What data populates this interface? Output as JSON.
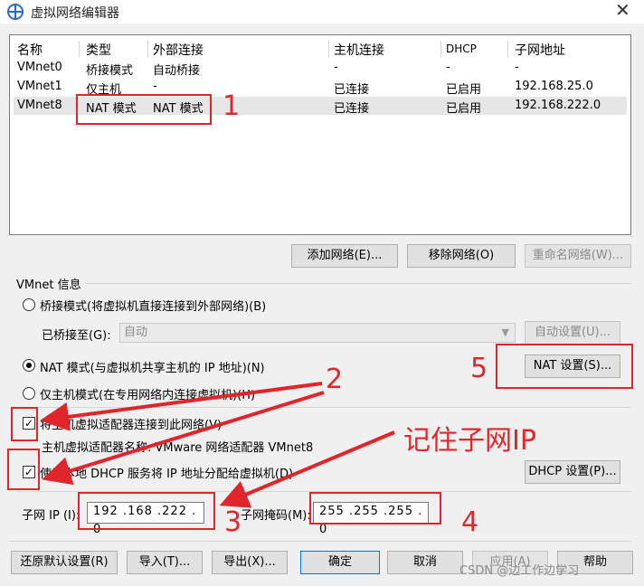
{
  "window": {
    "title": "虚拟网络编辑器",
    "close_glyph": "✕"
  },
  "table": {
    "headers": [
      "名称",
      "类型",
      "外部连接",
      "主机连接",
      "DHCP",
      "子网地址"
    ],
    "rows": [
      [
        "VMnet0",
        "桥接模式",
        "自动桥接",
        "-",
        "-",
        "-"
      ],
      [
        "VMnet1",
        "仅主机",
        "-",
        "已连接",
        "已启用",
        "192.168.25.0"
      ],
      [
        "VMnet8",
        "NAT 模式",
        "NAT 模式",
        "已连接",
        "已启用",
        "192.168.222.0"
      ]
    ]
  },
  "table_buttons": {
    "add": "添加网络(E)...",
    "remove": "移除网络(O)",
    "rename": "重命名网络(W)..."
  },
  "vmnet_info": {
    "section_label": "VMnet 信息",
    "bridge_radio": "桥接模式(将虚拟机直接连接到外部网络)(B)",
    "bridged_to_label": "已桥接至(G):",
    "bridged_to_value": "自动",
    "auto_settings": "自动设置(U)...",
    "nat_radio": "NAT 模式(与虚拟机共享主机的 IP 地址)(N)",
    "nat_settings": "NAT 设置(S)...",
    "hostonly_radio": "仅主机模式(在专用网络内连接虚拟机)(H)",
    "connect_adapter_check": "将主机虚拟适配器连接到此网络(V)",
    "adapter_name_label": "主机虚拟适配器名称: VMware 网络适配器 VMnet8",
    "dhcp_check": "使用本地 DHCP 服务将 IP 地址分配给虚拟机(D)",
    "dhcp_settings": "DHCP 设置(P)...",
    "subnet_ip_label": "子网 IP (I):",
    "subnet_ip_value": "192 .168 .222 . 0",
    "subnet_mask_label": "子网掩码(M):",
    "subnet_mask_value": "255 .255 .255 . 0"
  },
  "bottom_buttons": {
    "restore": "还原默认设置(R)",
    "import": "导入(T)...",
    "export": "导出(X)...",
    "ok": "确定",
    "cancel": "取消",
    "apply": "应用(A)",
    "help": "帮助"
  },
  "annotations": {
    "n1": "1",
    "n2": "2",
    "n3": "3",
    "n4": "4",
    "n5": "5",
    "remember": "记住子网IP",
    "color": "#e0252b"
  },
  "watermark": "CSDN @边工作边学习",
  "check_glyph": "✓"
}
